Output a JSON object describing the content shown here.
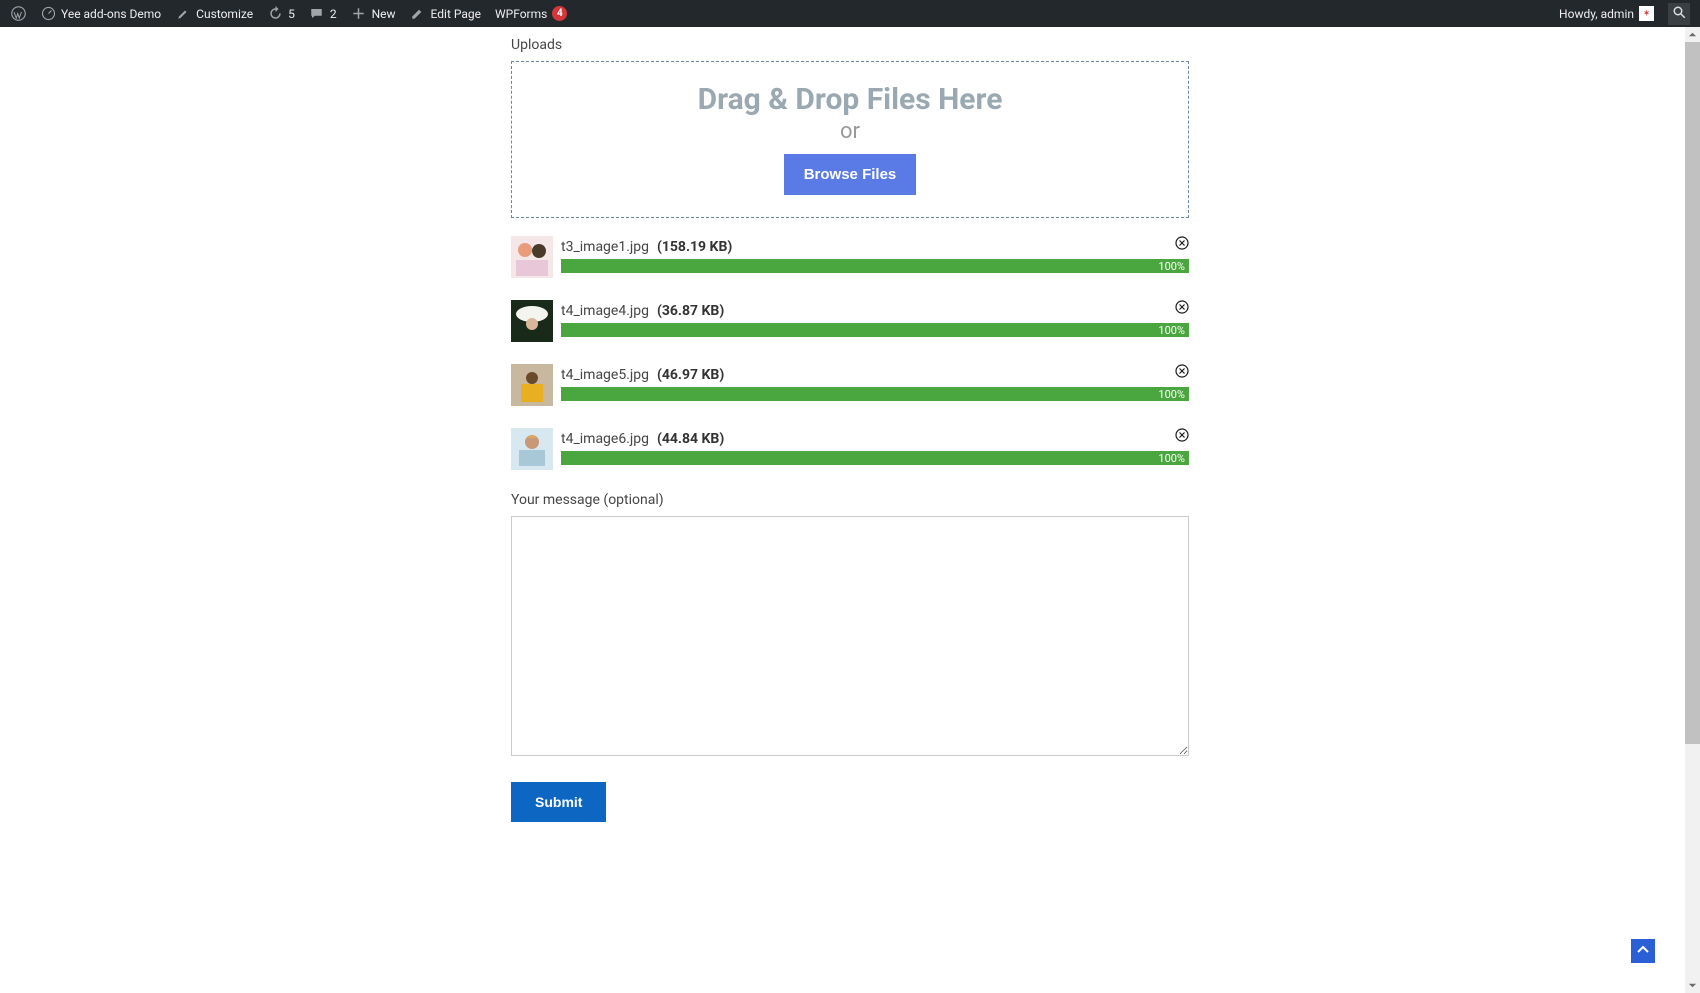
{
  "adminbar": {
    "site_name": "Yee add-ons Demo",
    "customize": "Customize",
    "updates_count": "5",
    "comments_count": "2",
    "new_label": "New",
    "edit_page": "Edit Page",
    "wpforms_label": "WPForms",
    "wpforms_badge": "4",
    "howdy": "Howdy, admin"
  },
  "uploads": {
    "label": "Uploads",
    "dz_title": "Drag & Drop Files Here",
    "dz_or": "or",
    "browse_label": "Browse Files",
    "files": [
      {
        "name": "t3_image1.jpg",
        "size": "(158.19 KB)",
        "progress": "100%"
      },
      {
        "name": "t4_image4.jpg",
        "size": "(36.87 KB)",
        "progress": "100%"
      },
      {
        "name": "t4_image5.jpg",
        "size": "(46.97 KB)",
        "progress": "100%"
      },
      {
        "name": "t4_image6.jpg",
        "size": "(44.84 KB)",
        "progress": "100%"
      }
    ]
  },
  "message": {
    "label": "Your message (optional)",
    "value": ""
  },
  "submit_label": "Submit"
}
